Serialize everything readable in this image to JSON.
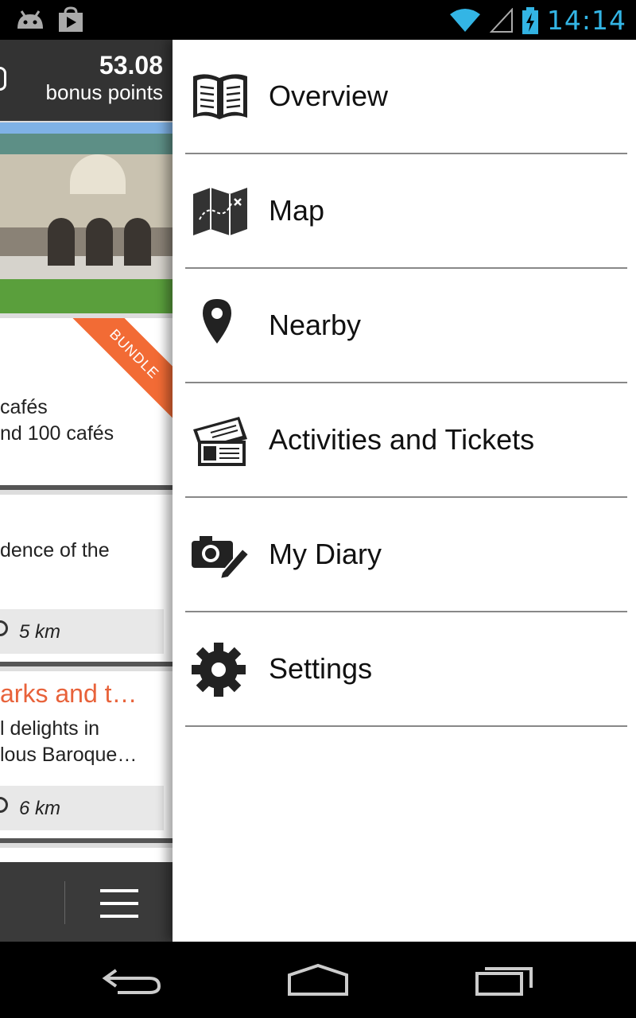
{
  "status_bar": {
    "time": "14:14",
    "icons": [
      "android-icon",
      "play-store-icon",
      "wifi-icon",
      "signal-icon",
      "battery-charging-icon"
    ],
    "accent_color": "#33b5e5"
  },
  "left_panel": {
    "bonus_value": "53.08",
    "bonus_label": "bonus points",
    "ribbon_label": "BUNDLE",
    "card1_line1": "cafés",
    "card1_line2": "nd 100 cafés",
    "card2_line1": "dence of the",
    "card2_distance": "5 km",
    "card3_title": "arks and t…",
    "card3_line1": "l delights in",
    "card3_line2": "lous Baroque…",
    "card3_distance": "6 km",
    "accent_color": "#f26b35"
  },
  "drawer": {
    "items": [
      {
        "label": "Overview",
        "icon": "book-icon"
      },
      {
        "label": "Map",
        "icon": "map-icon"
      },
      {
        "label": "Nearby",
        "icon": "location-pin-icon"
      },
      {
        "label": "Activities and Tickets",
        "icon": "tickets-icon"
      },
      {
        "label": "My Diary",
        "icon": "camera-pencil-icon"
      },
      {
        "label": "Settings",
        "icon": "gear-icon"
      }
    ]
  },
  "nav_bar": {
    "buttons": [
      "back-icon",
      "home-icon",
      "recents-icon"
    ]
  }
}
